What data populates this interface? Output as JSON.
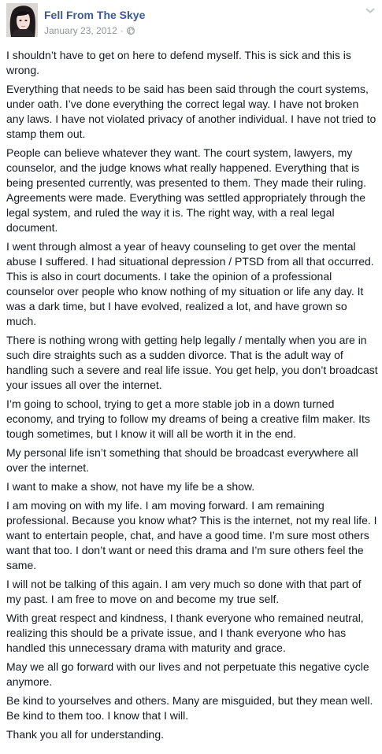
{
  "post": {
    "author": "Fell From The Skye",
    "date": "January 23, 2012",
    "separator": "·",
    "privacy_icon": "globe-icon",
    "menu_icon": "chevron-down-icon",
    "paragraphs": [
      "I shouldn’t have to get on here to defend myself. This is sick and this is wrong.",
      "Everything that needs to be said has been said through the court systems, under oath. I’ve done everything the correct legal way. I have not broken any laws. I have not violated privacy of another individual. I have not tried to stamp them out.",
      "People can believe whatever they want. The court system, lawyers, my counselor, and the judge knows what really happened. Everything that is being presented currently, was presented to them. They made their ruling. Agreements were made. Everything was settled appropriately through the legal system, and ruled the way it is. The right way, with a real legal document.",
      "I went through almost a year of heavy counseling to get over the mental abuse I suffered. I had situational depression / PTSD from all that occurred. This is also in court documents. I take the opinion of a professional counselor over people who know nothing of my situation or life any day. It was a dark time, but I have evolved, realized a lot, and have grown so much.",
      "There is nothing wrong with getting help legally / mentally when you are in such dire straights such as a sudden divorce. That is the adult way of handling such a severe and real life issue. You get help, you don’t broadcast your issues all over the internet.",
      "I’m going to school, trying to get a more stable job in a down turned economy, and trying to follow my dreams of being a creative film maker. Its tough sometimes, but I know it will all be worth it in the end.",
      "My personal life isn’t something that should be broadcast everywhere all over the internet.",
      "I want to make a show, not have my life be a show.",
      "I am moving on with my life. I am moving forward. I am remaining professional. Because you know what? This is the internet, not my real life. I want to entertain people, chat, and have a good time. I’m sure most others want that too. I don’t want or need this drama and I’m sure others feel the same.",
      "I will not be talking of this again. I am very much so done with that part of my past. I am free to move on and become my true self.",
      "With great respect and kindness, I thank everyone who remained neutral, realizing this should be a private issue, and I thank everyone who has handled this unnecessary drama with maturity and grace.",
      "May we all go forward with our lives and not perpetuate this negative cycle anymore.",
      "Be kind to yourselves and others. Many are misguided, but they mean well. Be kind to them too. I know that I will.",
      "Thank you all for understanding."
    ]
  }
}
